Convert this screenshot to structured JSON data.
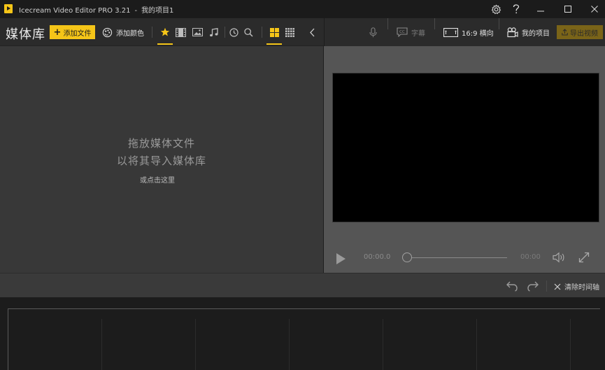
{
  "window": {
    "app_name": "Icecream Video Editor PRO 3.21",
    "separator": "-",
    "project_name": "我的项目1"
  },
  "library": {
    "title": "媒体库",
    "add_file_label": "添加文件",
    "add_color_label": "添加颜色",
    "drop_line1": "拖放媒体文件",
    "drop_line2": "以将其导入媒体库",
    "click_here": "或点击这里"
  },
  "preview_toolbar": {
    "subtitles_label": "字幕",
    "aspect_label": "16:9 横向",
    "project_label": "我的项目",
    "export_label": "导出视频"
  },
  "player": {
    "current_time": "00:00.0",
    "end_time": "00:00"
  },
  "timeline": {
    "clear_label": "清除时间轴"
  },
  "colors": {
    "accent": "#f5c518",
    "export_disabled": "#7a6418"
  }
}
